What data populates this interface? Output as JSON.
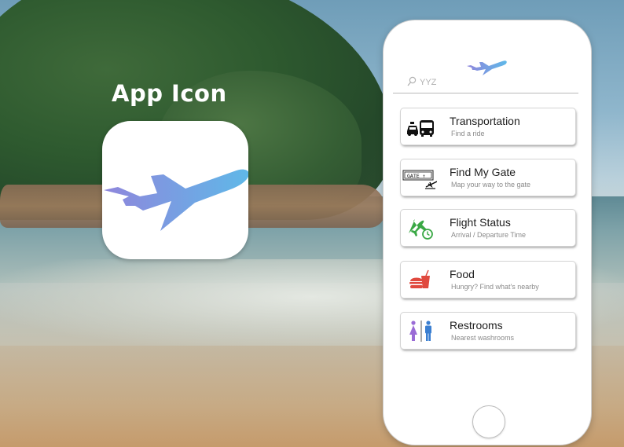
{
  "hero": {
    "title": "App Icon"
  },
  "app": {
    "search": {
      "placeholder": "YYZ",
      "icon": "search-icon"
    },
    "menu": [
      {
        "id": "transportation",
        "title": "Transportation",
        "subtitle": "Find a ride",
        "icon": "taxi-bus-icon"
      },
      {
        "id": "find-my-gate",
        "title": "Find My Gate",
        "subtitle": "Map your way to the gate",
        "icon": "gate-sign-icon",
        "icon_text": "GATE ↑"
      },
      {
        "id": "flight-status",
        "title": "Flight Status",
        "subtitle": "Arrival / Departure Time",
        "icon": "plane-clock-icon"
      },
      {
        "id": "food",
        "title": "Food",
        "subtitle": "Hungry? Find what's nearby",
        "icon": "burger-drink-icon"
      },
      {
        "id": "restrooms",
        "title": "Restrooms",
        "subtitle": "Nearest washrooms",
        "icon": "restroom-icon"
      }
    ]
  },
  "colors": {
    "plane_gradient_start": "#8f86dc",
    "plane_gradient_end": "#5fb8e8",
    "flight_status_green": "#3aa845",
    "food_red": "#e0493e",
    "restroom_purple": "#9a6bd6",
    "restroom_blue": "#3b7fd1"
  }
}
